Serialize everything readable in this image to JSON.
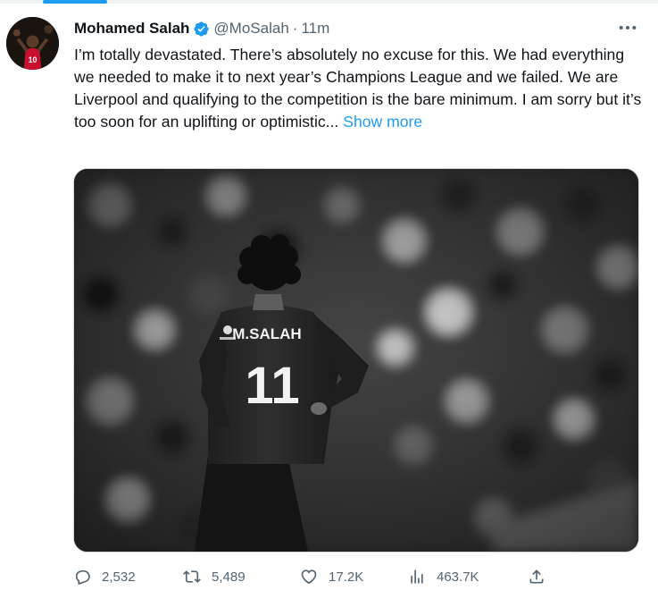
{
  "tweet": {
    "author": {
      "display_name": "Mohamed Salah",
      "handle": "@MoSalah",
      "verified": true
    },
    "separator": "·",
    "time": "11m",
    "text": "I’m totally devastated. There’s absolutely no excuse for this. We had everything we needed to make it to next year’s Champions League and we failed. We are Liverpool and qualifying to the competition is the bare minimum. I am sorry but it’s too soon for an uplifting or optimistic...",
    "show_more": "Show more",
    "media": {
      "jersey_name": "M.SALAH",
      "jersey_number": "11"
    },
    "stats": {
      "replies": "2,532",
      "retweets": "5,489",
      "likes": "17.2K",
      "views": "463.7K"
    }
  },
  "colors": {
    "accent": "#1d9bf0",
    "text": "#0f1419",
    "muted": "#536471",
    "border": "#cfd9de"
  }
}
